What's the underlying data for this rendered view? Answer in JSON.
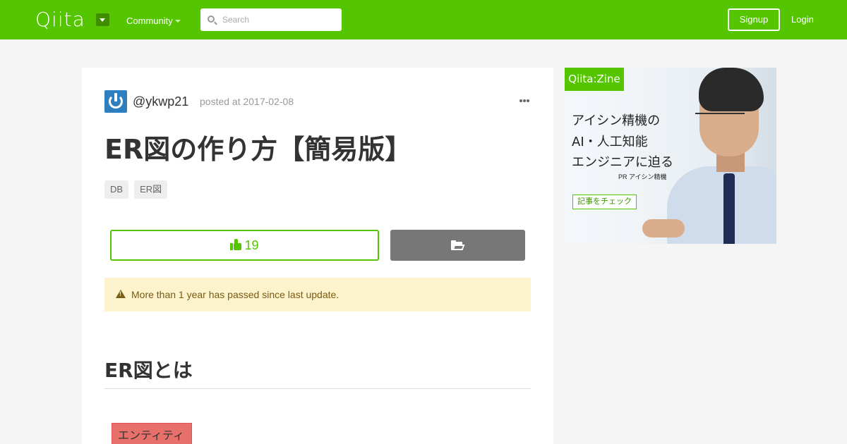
{
  "header": {
    "logo": "Qiita",
    "nav_community": "Community",
    "search_placeholder": "Search",
    "signup_label": "Signup",
    "login_label": "Login",
    "brand_color": "#55c500"
  },
  "article": {
    "author": "@ykwp21",
    "posted": "posted at 2017-02-08",
    "title": "ER図の作り方【簡易版】",
    "tags": [
      "DB",
      "ER図"
    ],
    "like_count": "19",
    "alert_text": "More than 1 year has passed since last update.",
    "heading": "ER図とは",
    "entity_label": "エンティティ"
  },
  "ad": {
    "badge": "Qiita:Zine",
    "lines": [
      "アイシン精機の",
      "AI・人工知能",
      "エンジニアに迫る"
    ],
    "pr": "PR  アイシン精機",
    "cta": "記事をチェック"
  }
}
